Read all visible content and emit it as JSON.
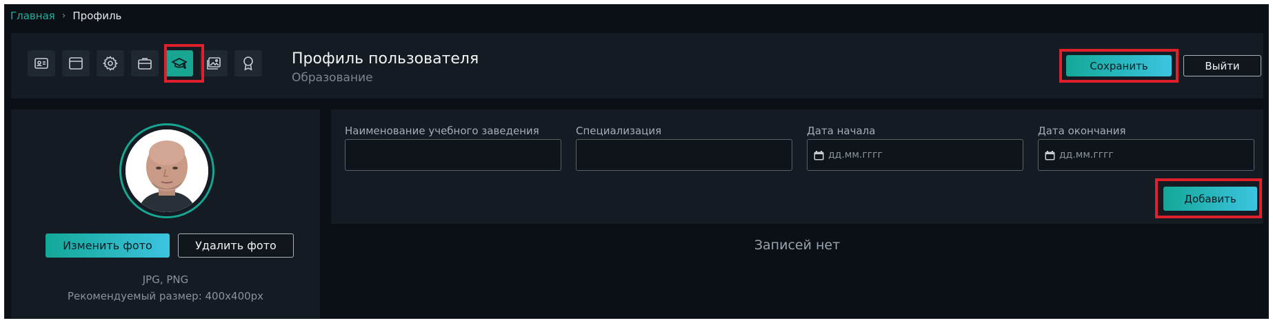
{
  "breadcrumb": {
    "home": "Главная",
    "separator": "›",
    "current": "Профиль"
  },
  "tabs": [
    {
      "icon": "id-card-icon",
      "active": false
    },
    {
      "icon": "window-icon",
      "active": false
    },
    {
      "icon": "gear-icon",
      "active": false
    },
    {
      "icon": "briefcase-icon",
      "active": false
    },
    {
      "icon": "graduation-cap-icon",
      "active": true
    },
    {
      "icon": "image-icon",
      "active": false
    },
    {
      "icon": "award-icon",
      "active": false
    }
  ],
  "header": {
    "title": "Профиль пользователя",
    "subtitle": "Образование",
    "save_label": "Сохранить",
    "exit_label": "Выйти"
  },
  "photo": {
    "change_label": "Изменить фото",
    "delete_label": "Удалить фото",
    "formats": "JPG, PNG",
    "recommended": "Рекомендуемый размер: 400x400px"
  },
  "education_form": {
    "institution_label": "Наименование учебного заведения",
    "institution_value": "",
    "specialization_label": "Специализация",
    "specialization_value": "",
    "start_label": "Дата начала",
    "start_placeholder": "дд.мм.гггг",
    "end_label": "Дата окончания",
    "end_placeholder": "дд.мм.гггг",
    "add_label": "Добавить"
  },
  "records": {
    "empty_text": "Записей нет"
  },
  "colors": {
    "accent": "#18a592",
    "highlight": "#e2202b",
    "background": "#0b1016",
    "card": "#141b22"
  }
}
